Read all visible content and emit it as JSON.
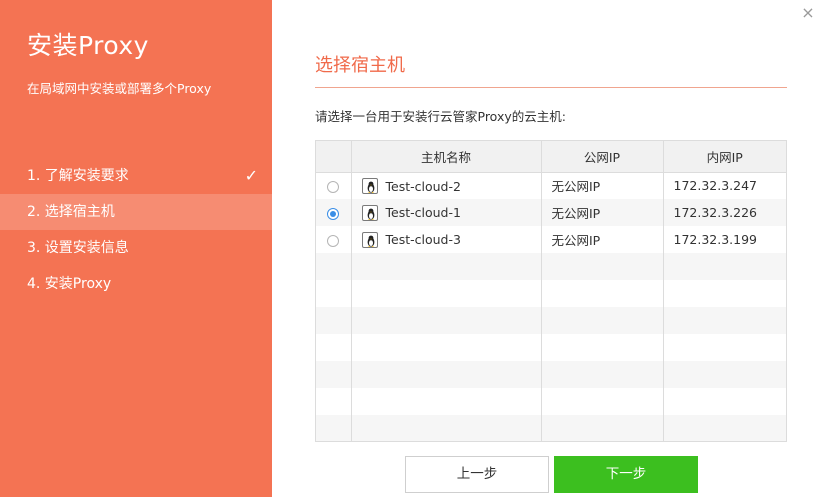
{
  "sidebar": {
    "title": "安装Proxy",
    "subtitle": "在局域网中安装或部署多个Proxy",
    "steps": [
      {
        "label": "1. 了解安装要求",
        "state": "done"
      },
      {
        "label": "2. 选择宿主机",
        "state": "active"
      },
      {
        "label": "3. 设置安装信息",
        "state": "pending"
      },
      {
        "label": "4. 安装Proxy",
        "state": "pending"
      }
    ],
    "check_icon": "✓"
  },
  "close_icon": "×",
  "main": {
    "heading": "选择宿主机",
    "instruction": "请选择一台用于安装行云管家Proxy的云主机:",
    "table": {
      "columns": [
        "主机名称",
        "公网IP",
        "内网IP"
      ],
      "rows": [
        {
          "selected": false,
          "name": "Test-cloud-2",
          "public_ip": "无公网IP",
          "private_ip": "172.32.3.247",
          "os_icon": "linux-icon"
        },
        {
          "selected": true,
          "name": "Test-cloud-1",
          "public_ip": "无公网IP",
          "private_ip": "172.32.3.226",
          "os_icon": "linux-icon"
        },
        {
          "selected": false,
          "name": "Test-cloud-3",
          "public_ip": "无公网IP",
          "private_ip": "172.32.3.199",
          "os_icon": "linux-icon"
        }
      ]
    },
    "buttons": {
      "prev": "上一步",
      "next": "下一步"
    }
  },
  "colors": {
    "sidebar": "#f47353",
    "heading": "#f06a4a",
    "next_button": "#3cbf1f",
    "radio_checked": "#3a8ee6"
  }
}
